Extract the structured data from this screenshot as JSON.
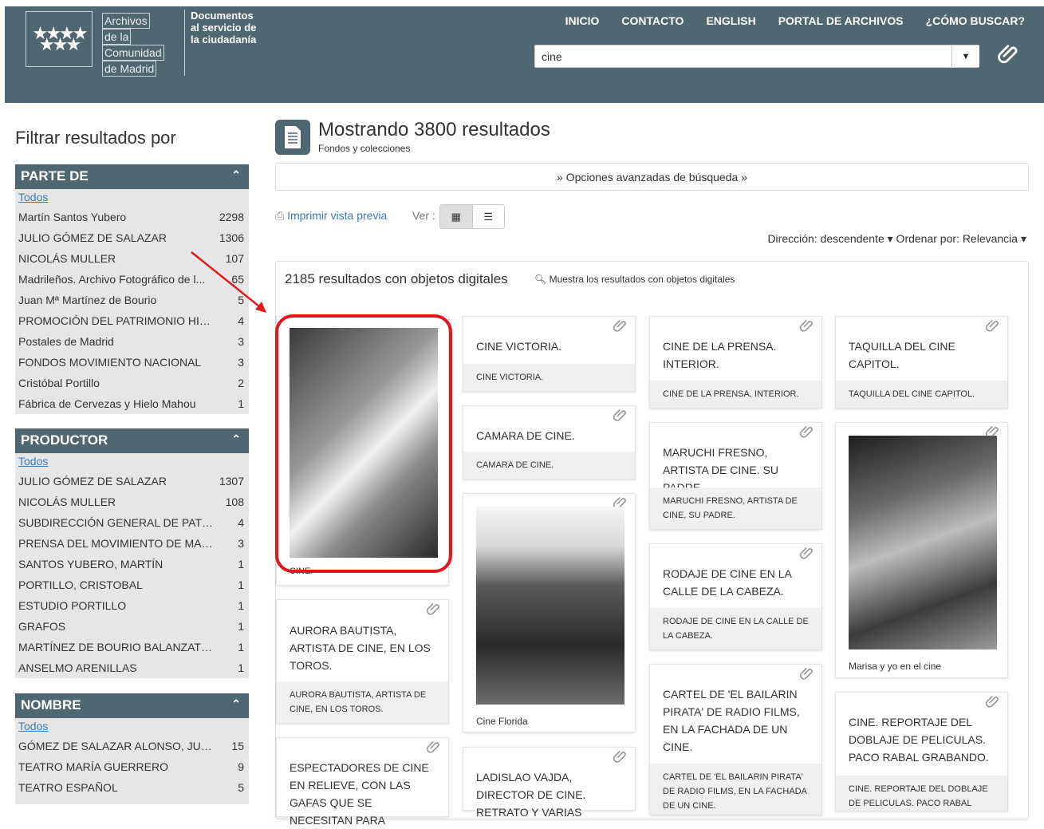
{
  "header": {
    "logo_lines": [
      "Archivos",
      "de la",
      "Comunidad",
      "de Madrid"
    ],
    "tagline": [
      "Documentos",
      "al servicio de",
      "la ciudadanía"
    ],
    "nav": [
      "INICIO",
      "CONTACTO",
      "ENGLISH",
      "PORTAL DE ARCHIVOS",
      "¿CÓMO BUSCAR?"
    ],
    "search_value": "cine"
  },
  "sidebar": {
    "title": "Filtrar resultados por",
    "all_label": "Todos",
    "facets": [
      {
        "name": "PARTE DE",
        "rows": [
          {
            "label": "Martín Santos Yubero",
            "count": "2298"
          },
          {
            "label": "JULIO GÓMEZ DE SALAZAR",
            "count": "1306"
          },
          {
            "label": "NICOLÁS MULLER",
            "count": "107"
          },
          {
            "label": "Madrileños. Archivo Fotográfico de l...",
            "count": "65"
          },
          {
            "label": "Juan Mª Martínez de Bourio",
            "count": "5"
          },
          {
            "label": "PROMOCIÓN DEL PATRIMONIO HIST...",
            "count": "4"
          },
          {
            "label": "Postales de Madrid",
            "count": "3"
          },
          {
            "label": "FONDOS MOVIMIENTO NACIONAL",
            "count": "3"
          },
          {
            "label": "Cristóbal Portillo",
            "count": "2"
          },
          {
            "label": "Fábrica de Cervezas y Hielo Mahou",
            "count": "1"
          }
        ]
      },
      {
        "name": "PRODUCTOR",
        "rows": [
          {
            "label": "JULIO GÓMEZ DE SALAZAR",
            "count": "1307"
          },
          {
            "label": "NICOLÁS MULLER",
            "count": "108"
          },
          {
            "label": "SUBDIRECCIÓN GENERAL DE PATRIM...",
            "count": "4"
          },
          {
            "label": "PRENSA DEL MOVIMIENTO DE MADR...",
            "count": "3"
          },
          {
            "label": "SANTOS YUBERO, MARTÍN",
            "count": "1"
          },
          {
            "label": "PORTILLO, CRISTOBAL",
            "count": "1"
          },
          {
            "label": "ESTUDIO PORTILLO",
            "count": "1"
          },
          {
            "label": "GRAFOS",
            "count": "1"
          },
          {
            "label": "MARTÍNEZ DE BOURIO BALANZATEG...",
            "count": "1"
          },
          {
            "label": "ANSELMO ARENILLAS",
            "count": "1"
          }
        ]
      },
      {
        "name": "NOMBRE",
        "rows": [
          {
            "label": "GÓMEZ DE SALAZAR ALONSO, JULIO ...",
            "count": "15"
          },
          {
            "label": "TEATRO MARÍA GUERRERO",
            "count": "9"
          },
          {
            "label": "TEATRO ESPAÑOL",
            "count": "5"
          }
        ]
      }
    ]
  },
  "main": {
    "title": "Mostrando 3800 resultados",
    "subtitle": "Fondos y colecciones",
    "advanced": "Opciones avanzadas de búsqueda",
    "print": "Imprimir vista previa",
    "ver": "Ver :",
    "sort": "Dirección: descendente  ▾ Ordenar por: Relevancia  ▾",
    "digital_count": "2185 resultados con objetos digitales",
    "digital_link": "Muestra los resultados con objetos digitales"
  },
  "cards": {
    "c1_cap": "CINE.",
    "c2_title": "AURORA BAUTISTA, ARTISTA DE CINE, EN LOS TOROS.",
    "c2_cap": "AURORA BAUTISTA, ARTISTA DE CINE, EN LOS TOROS.",
    "c3_title": "ESPECTADORES DE CINE EN RELIEVE, CON LAS GAFAS QUE SE NECESITAN PARA",
    "c4_title": "CINE VICTORIA.",
    "c4_cap": "CINE VICTORIA.",
    "c5_title": "CAMARA DE CINE.",
    "c5_cap": "CAMARA DE CINE.",
    "c6_cap": "Cine Florida",
    "c7_title": "LADISLAO VAJDA, DIRECTOR DE CINE. RETRATO Y VARIAS",
    "c8_title": "CINE DE LA PRENSA. INTERIOR.",
    "c8_cap": "CINE DE LA PRENSA. INTERIOR.",
    "c9_title": "MARUCHI FRESNO, ARTISTA DE CINE. SU PADRE.",
    "c9_cap": "MARUCHI FRESNO, ARTISTA DE CINE. SU PADRE.",
    "c10_title": "RODAJE DE CINE EN LA CALLE DE LA CABEZA.",
    "c10_cap": "RODAJE DE CINE EN LA CALLE DE LA CABEZA.",
    "c11_title": "CARTEL DE 'EL BAILARIN PIRATA' DE RADIO FILMS, EN LA FACHADA DE UN CINE.",
    "c11_cap": "CARTEL DE 'EL BAILARIN PIRATA' DE RADIO FILMS, EN LA FACHADA DE UN CINE.",
    "c12_title": "TAQUILLA DEL CINE CAPITOL.",
    "c12_cap": "TAQUILLA DEL CINE CAPITOL.",
    "c13_cap": "Marisa y yo en el cine",
    "c14_title": "CINE. REPORTAJE DEL DOBLAJE DE PELICULAS. PACO RABAL GRABANDO.",
    "c14_cap": "CINE. REPORTAJE DEL DOBLAJE DE PELICULAS. PACO RABAL"
  }
}
